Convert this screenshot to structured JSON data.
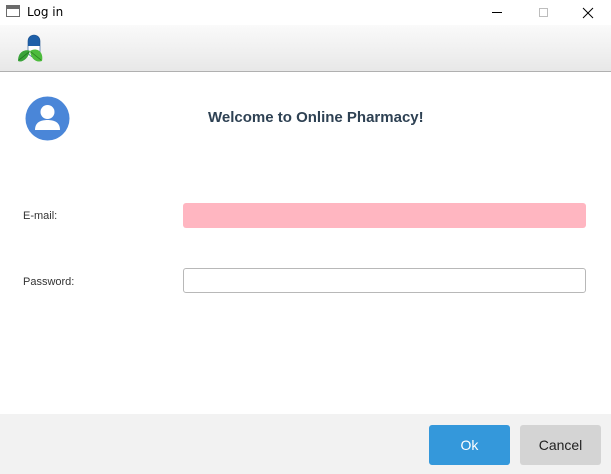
{
  "window": {
    "title": "Log in"
  },
  "toolbar": {
    "logo_icon": "pharmacy-logo-icon"
  },
  "header": {
    "avatar_icon": "user-avatar-icon",
    "welcome_text": "Welcome to Online Pharmacy!"
  },
  "form": {
    "email_label": "E-mail:",
    "email_value": "",
    "password_label": "Password:",
    "password_value": ""
  },
  "footer": {
    "ok_label": "Ok",
    "cancel_label": "Cancel"
  },
  "colors": {
    "accent": "#3498db",
    "email_invalid_bg": "#ffb6c1",
    "heading": "#2e4153"
  }
}
